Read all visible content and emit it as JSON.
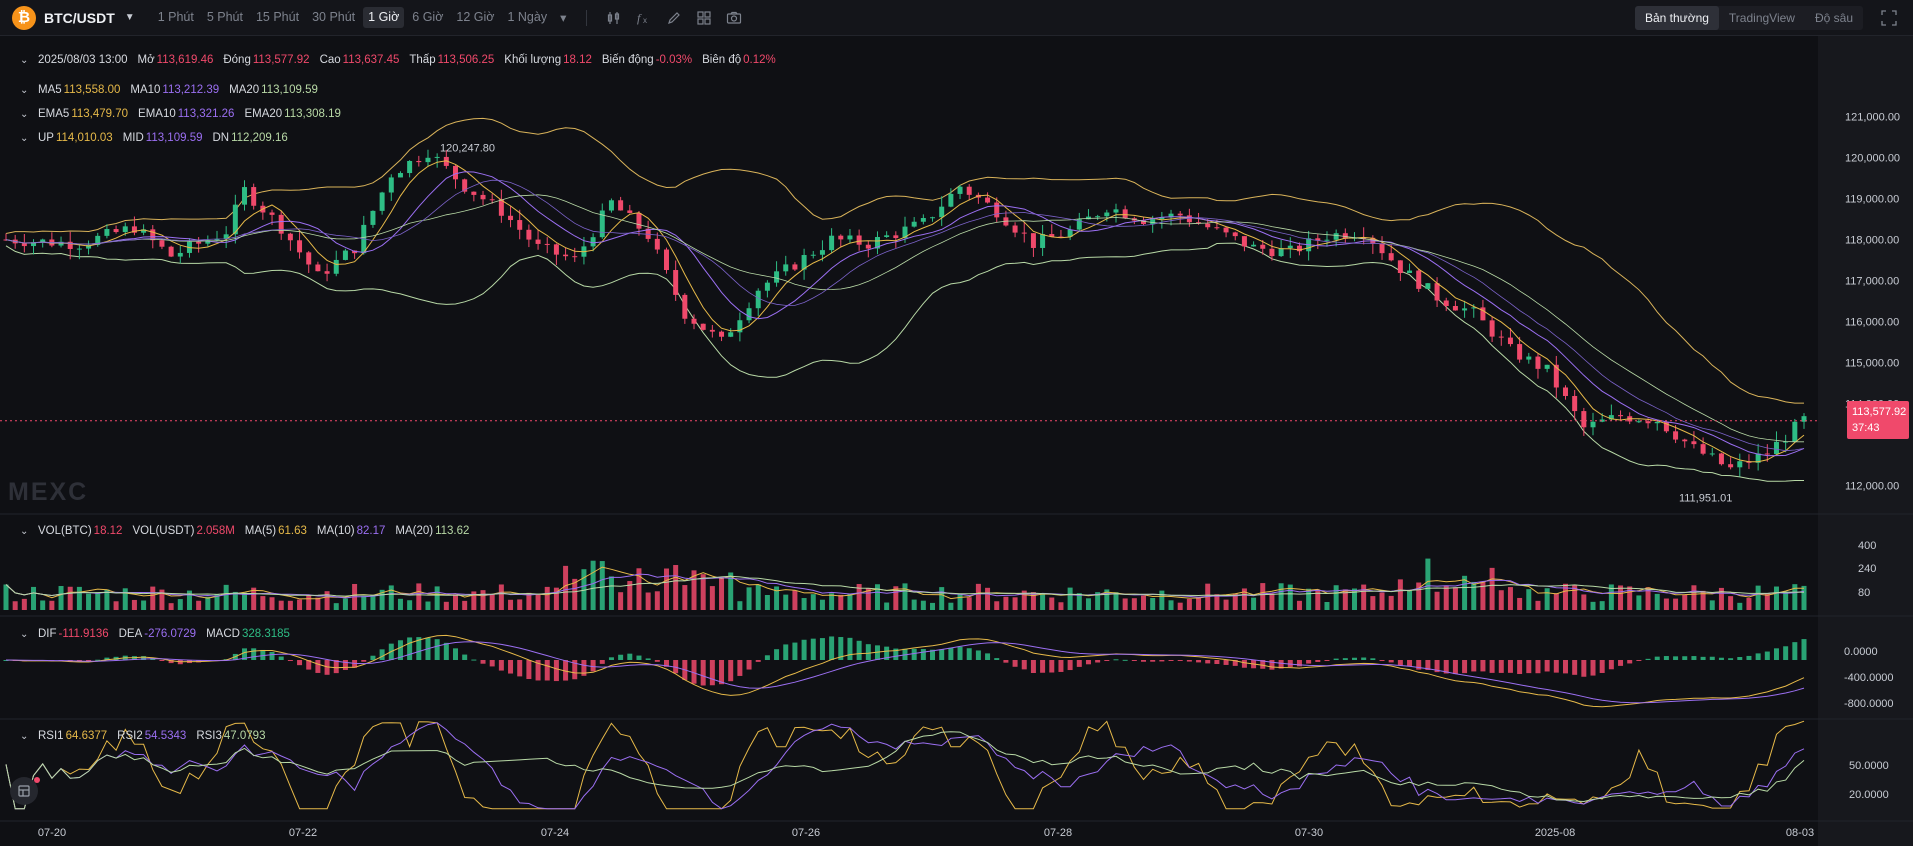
{
  "header": {
    "pair": "BTC/USDT",
    "coin_glyph": "₿",
    "intervals": [
      {
        "label": "1 Phút",
        "active": false
      },
      {
        "label": "5 Phút",
        "active": false
      },
      {
        "label": "15 Phút",
        "active": false
      },
      {
        "label": "30 Phút",
        "active": false
      },
      {
        "label": "1 Giờ",
        "active": true
      },
      {
        "label": "6 Giờ",
        "active": false
      },
      {
        "label": "12 Giờ",
        "active": false
      },
      {
        "label": "1 Ngày",
        "active": false
      }
    ],
    "view_tabs": [
      {
        "label": "Bản thường",
        "active": true
      },
      {
        "label": "TradingView",
        "active": false
      },
      {
        "label": "Độ sâu",
        "active": false
      }
    ],
    "tools": [
      "candle-settings-icon",
      "indicator-icon",
      "draw-icon",
      "layout-grid-icon",
      "camera-icon"
    ]
  },
  "ohlc": {
    "date": "2025/08/03 13:00",
    "open_label": "Mở",
    "open": "113,619.46",
    "close_label": "Đóng",
    "close": "113,577.92",
    "high_label": "Cao",
    "high": "113,637.45",
    "low_label": "Thấp",
    "low": "113,506.25",
    "volume_label": "Khối lượng",
    "volume": "18.12",
    "change_label": "Biến động",
    "change": "-0.03%",
    "amplitude_label": "Biên độ",
    "amplitude": "0.12%"
  },
  "ma": {
    "ma5_label": "MA5",
    "ma5": "113,558.00",
    "ma10_label": "MA10",
    "ma10": "113,212.39",
    "ma20_label": "MA20",
    "ma20": "113,109.59"
  },
  "ema": {
    "ema5_label": "EMA5",
    "ema5": "113,479.70",
    "ema10_label": "EMA10",
    "ema10": "113,321.26",
    "ema20_label": "EMA20",
    "ema20": "113,308.19"
  },
  "boll": {
    "up_label": "UP",
    "up": "114,010.03",
    "mid_label": "MID",
    "mid": "113,109.59",
    "dn_label": "DN",
    "dn": "112,209.16"
  },
  "vol": {
    "btc_label": "VOL(BTC)",
    "btc": "18.12",
    "usdt_label": "VOL(USDT)",
    "usdt": "2.058M",
    "ma5_label": "MA(5)",
    "ma5": "61.63",
    "ma10_label": "MA(10)",
    "ma10": "82.17",
    "ma20_label": "MA(20)",
    "ma20": "113.62"
  },
  "macd": {
    "dif_label": "DIF",
    "dif": "-111.9136",
    "dea_label": "DEA",
    "dea": "-276.0729",
    "macd_label": "MACD",
    "macd": "328.3185"
  },
  "rsi": {
    "rsi1_label": "RSI1",
    "rsi1": "64.6377",
    "rsi2_label": "RSI2",
    "rsi2": "54.5343",
    "rsi3_label": "RSI3",
    "rsi3": "47.0793"
  },
  "last_price": "113,577.92",
  "countdown": "37:43",
  "max_label": "120,247.80",
  "min_label": "111,951.01",
  "watermark": "MEXC",
  "colors": {
    "up": "#2ebd85",
    "down": "#f0496b",
    "ma5": "#e6b949",
    "ma10": "#9b6ff2",
    "ma20": "#b8d9a6",
    "boll": "#d9b35a"
  },
  "chart_data": {
    "type": "candlestick",
    "price_axis": [
      "121,000.00",
      "120,000.00",
      "119,000.00",
      "118,000.00",
      "117,000.00",
      "116,000.00",
      "115,000.00",
      "114,000.00",
      "112,000.00"
    ],
    "price_range": [
      111500,
      121500
    ],
    "date_axis": [
      "07-20",
      "07-22",
      "07-24",
      "07-26",
      "07-28",
      "07-30",
      "2025-08",
      "08-03"
    ],
    "volume_axis": [
      "400",
      "240",
      "80"
    ],
    "macd_axis": [
      "0.0000",
      "-400.0000",
      "-800.0000"
    ],
    "rsi_axis": [
      "50.0000",
      "20.0000"
    ],
    "price_path": [
      [
        0,
        118000
      ],
      [
        8,
        117900
      ],
      [
        14,
        118300
      ],
      [
        18,
        117600
      ],
      [
        24,
        118200
      ],
      [
        26,
        119200
      ],
      [
        30,
        118300
      ],
      [
        34,
        117100
      ],
      [
        38,
        117800
      ],
      [
        42,
        119600
      ],
      [
        46,
        120150
      ],
      [
        50,
        119300
      ],
      [
        54,
        118700
      ],
      [
        58,
        117800
      ],
      [
        62,
        117500
      ],
      [
        66,
        118900
      ],
      [
        70,
        118100
      ],
      [
        74,
        116200
      ],
      [
        78,
        115500
      ],
      [
        82,
        116800
      ],
      [
        86,
        117400
      ],
      [
        90,
        118000
      ],
      [
        94,
        117900
      ],
      [
        100,
        118400
      ],
      [
        104,
        119300
      ],
      [
        108,
        118700
      ],
      [
        112,
        117900
      ],
      [
        116,
        118200
      ],
      [
        120,
        118800
      ],
      [
        124,
        118500
      ],
      [
        128,
        118600
      ],
      [
        132,
        118200
      ],
      [
        136,
        117800
      ],
      [
        140,
        117700
      ],
      [
        144,
        118100
      ],
      [
        148,
        118200
      ],
      [
        152,
        117300
      ],
      [
        156,
        116600
      ],
      [
        160,
        116200
      ],
      [
        164,
        115300
      ],
      [
        168,
        114800
      ],
      [
        172,
        113400
      ],
      [
        176,
        113700
      ],
      [
        180,
        113600
      ],
      [
        184,
        112900
      ],
      [
        188,
        112400
      ],
      [
        192,
        112800
      ],
      [
        196,
        113600
      ]
    ],
    "bollinger": {
      "upper_end": 114010.03,
      "mid_end": 113109.59,
      "lower_end": 112209.16
    },
    "rsi_last": [
      64.6377,
      54.5343,
      47.0793
    ],
    "macd_last": {
      "dif": -111.9136,
      "dea": -276.0729,
      "macd": 328.3185
    }
  }
}
